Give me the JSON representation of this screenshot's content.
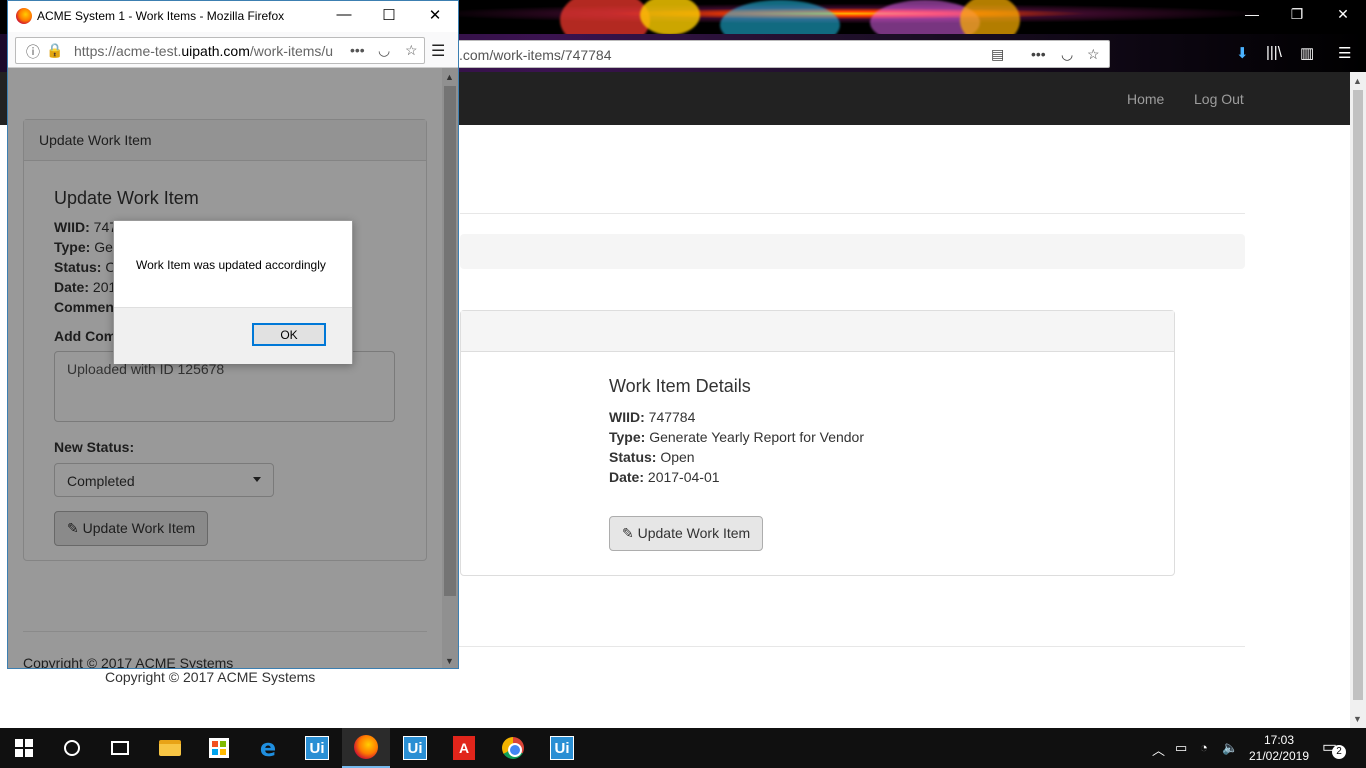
{
  "bg_browser": {
    "url_suffix": ".com/work-items/747784",
    "minimize": "—",
    "restore": "❐",
    "close": "✕"
  },
  "bg_app": {
    "nav": {
      "home": "Home",
      "logout": "Log Out"
    },
    "details": {
      "heading": "Work Item Details",
      "wiid_label": "WIID:",
      "wiid": "747784",
      "type_label": "Type:",
      "type": "Generate Yearly Report for Vendor",
      "status_label": "Status:",
      "status": "Open",
      "date_label": "Date:",
      "date": "2017-04-01"
    },
    "update_button": "Update Work Item",
    "footer": "Copyright © 2017 ACME Systems"
  },
  "fg_window": {
    "title": "ACME System 1 - Work Items - Mozilla Firefox",
    "url_prefix": "https://acme-test.",
    "url_domain": "uipath.com",
    "url_rest": "/work-items/u",
    "panel_header": "Update Work Item",
    "heading": "Update Work Item",
    "wiid_label": "WIID:",
    "wiid_partial": "747",
    "type_label": "Type:",
    "type_partial": "Ge",
    "status_label": "Status:",
    "status_partial": "O",
    "date_label": "Date:",
    "date_partial": "201",
    "comments_label": "Commen",
    "add_comment_label": "Add Com",
    "textarea_value": "Uploaded with ID 125678",
    "new_status_label": "New Status:",
    "new_status_value": "Completed",
    "update_button": "Update Work Item",
    "footer": "Copyright © 2017 ACME Systems"
  },
  "dialog": {
    "message": "Work Item was updated accordingly",
    "ok": "OK"
  },
  "taskbar": {
    "time": "17:03",
    "date": "21/02/2019",
    "notifications": "2",
    "ui_label": "Ui",
    "pdf_label": "A"
  }
}
